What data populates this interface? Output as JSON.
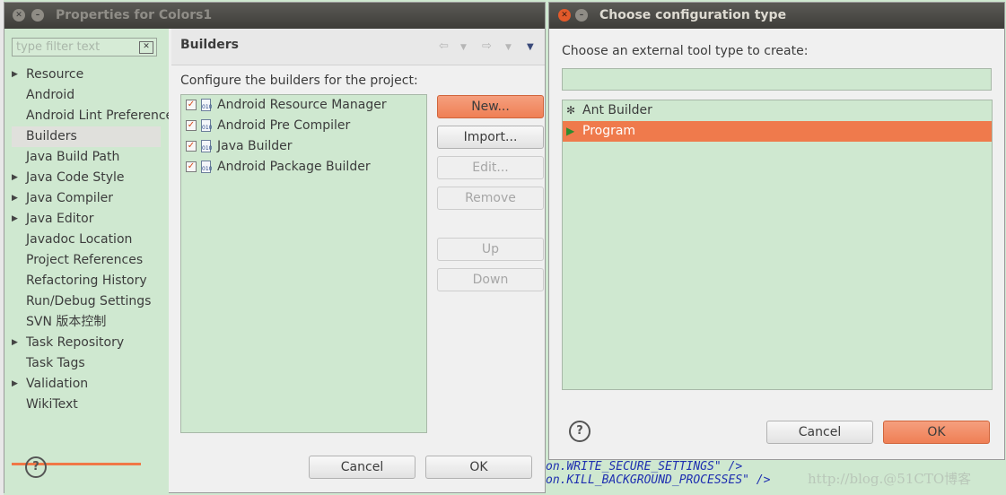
{
  "window1": {
    "title": "Properties for Colors1",
    "filter_placeholder": "type filter text",
    "filter_clear_glyph": "✕",
    "tree": [
      {
        "label": "Resource",
        "expandable": true
      },
      {
        "label": "Android",
        "expandable": false
      },
      {
        "label": "Android Lint Preferences",
        "expandable": false
      },
      {
        "label": "Builders",
        "expandable": false,
        "selected": true
      },
      {
        "label": "Java Build Path",
        "expandable": false
      },
      {
        "label": "Java Code Style",
        "expandable": true
      },
      {
        "label": "Java Compiler",
        "expandable": true
      },
      {
        "label": "Java Editor",
        "expandable": true
      },
      {
        "label": "Javadoc Location",
        "expandable": false
      },
      {
        "label": "Project References",
        "expandable": false
      },
      {
        "label": "Refactoring History",
        "expandable": false
      },
      {
        "label": "Run/Debug Settings",
        "expandable": false
      },
      {
        "label": "SVN 版本控制",
        "expandable": false
      },
      {
        "label": "Task Repository",
        "expandable": true
      },
      {
        "label": "Task Tags",
        "expandable": false
      },
      {
        "label": "Validation",
        "expandable": true
      },
      {
        "label": "WikiText",
        "expandable": false
      }
    ],
    "section_title": "Builders",
    "description": "Configure the builders for the project:",
    "builders": [
      {
        "label": "Android Resource Manager",
        "checked": true
      },
      {
        "label": "Android Pre Compiler",
        "checked": true
      },
      {
        "label": "Java Builder",
        "checked": true
      },
      {
        "label": "Android Package Builder",
        "checked": true
      }
    ],
    "buttons": {
      "new": "New...",
      "import": "Import...",
      "edit": "Edit...",
      "remove": "Remove",
      "up": "Up",
      "down": "Down"
    },
    "cancel": "Cancel",
    "ok": "OK"
  },
  "window2": {
    "title": "Choose configuration type",
    "prompt": "Choose an external tool type to create:",
    "search_value": "",
    "types": [
      {
        "label": "Ant Builder",
        "icon": "ant-icon",
        "selected": false
      },
      {
        "label": "Program",
        "icon": "program-icon",
        "selected": true
      }
    ],
    "cancel": "Cancel",
    "ok": "OK"
  },
  "background_code": [
    "on.WRITE_SECURE_SETTINGS\" />",
    "on.KILL_BACKGROUND_PROCESSES\" />"
  ],
  "watermark": "http://blog.@51CTO博客",
  "colors": {
    "accent": "#ef7a4c",
    "panel_green": "#cfe8d0",
    "titlebar": "#3e3d39"
  }
}
